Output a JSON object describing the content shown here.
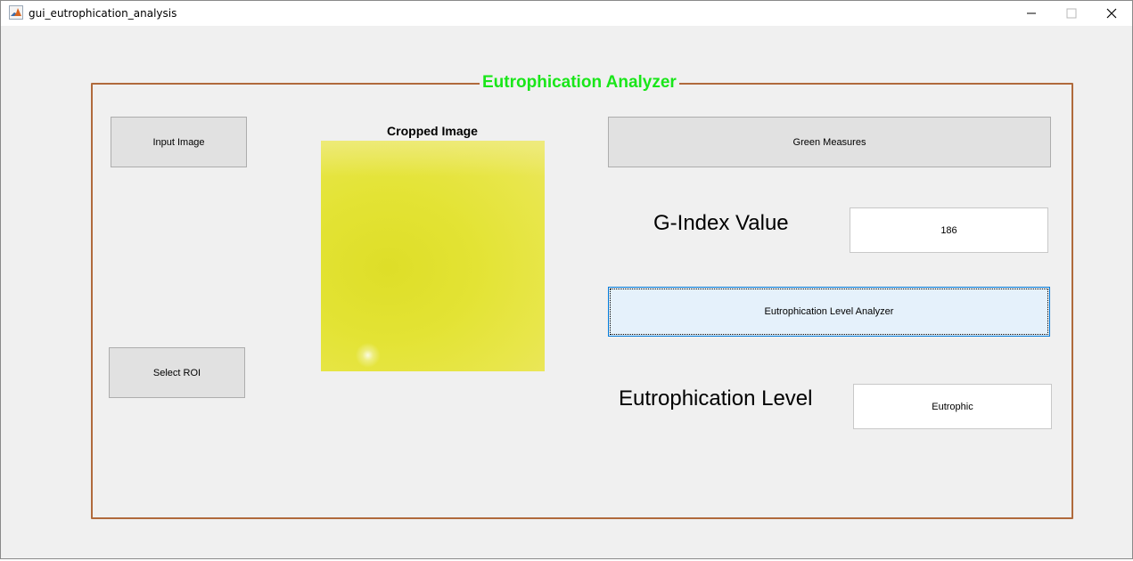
{
  "window": {
    "title": "gui_eutrophication_analysis"
  },
  "panel": {
    "title": "Eutrophication Analyzer"
  },
  "buttons": {
    "input_image": "Input Image",
    "select_roi": "Select ROI",
    "green_measures": "Green Measures",
    "level_analyzer": "Eutrophication Level Analyzer"
  },
  "axes": {
    "title": "Cropped Image"
  },
  "gindex": {
    "label": "G-Index Value",
    "value": "186"
  },
  "level": {
    "label": "Eutrophication Level",
    "value": "Eutrophic"
  },
  "icons": [
    "matlab-icon",
    "minimize-icon",
    "maximize-icon",
    "close-icon"
  ],
  "colors": {
    "panel_border": "#b06a3c",
    "panel_title": "#19e619",
    "focused_button": "#e5f1fb"
  }
}
